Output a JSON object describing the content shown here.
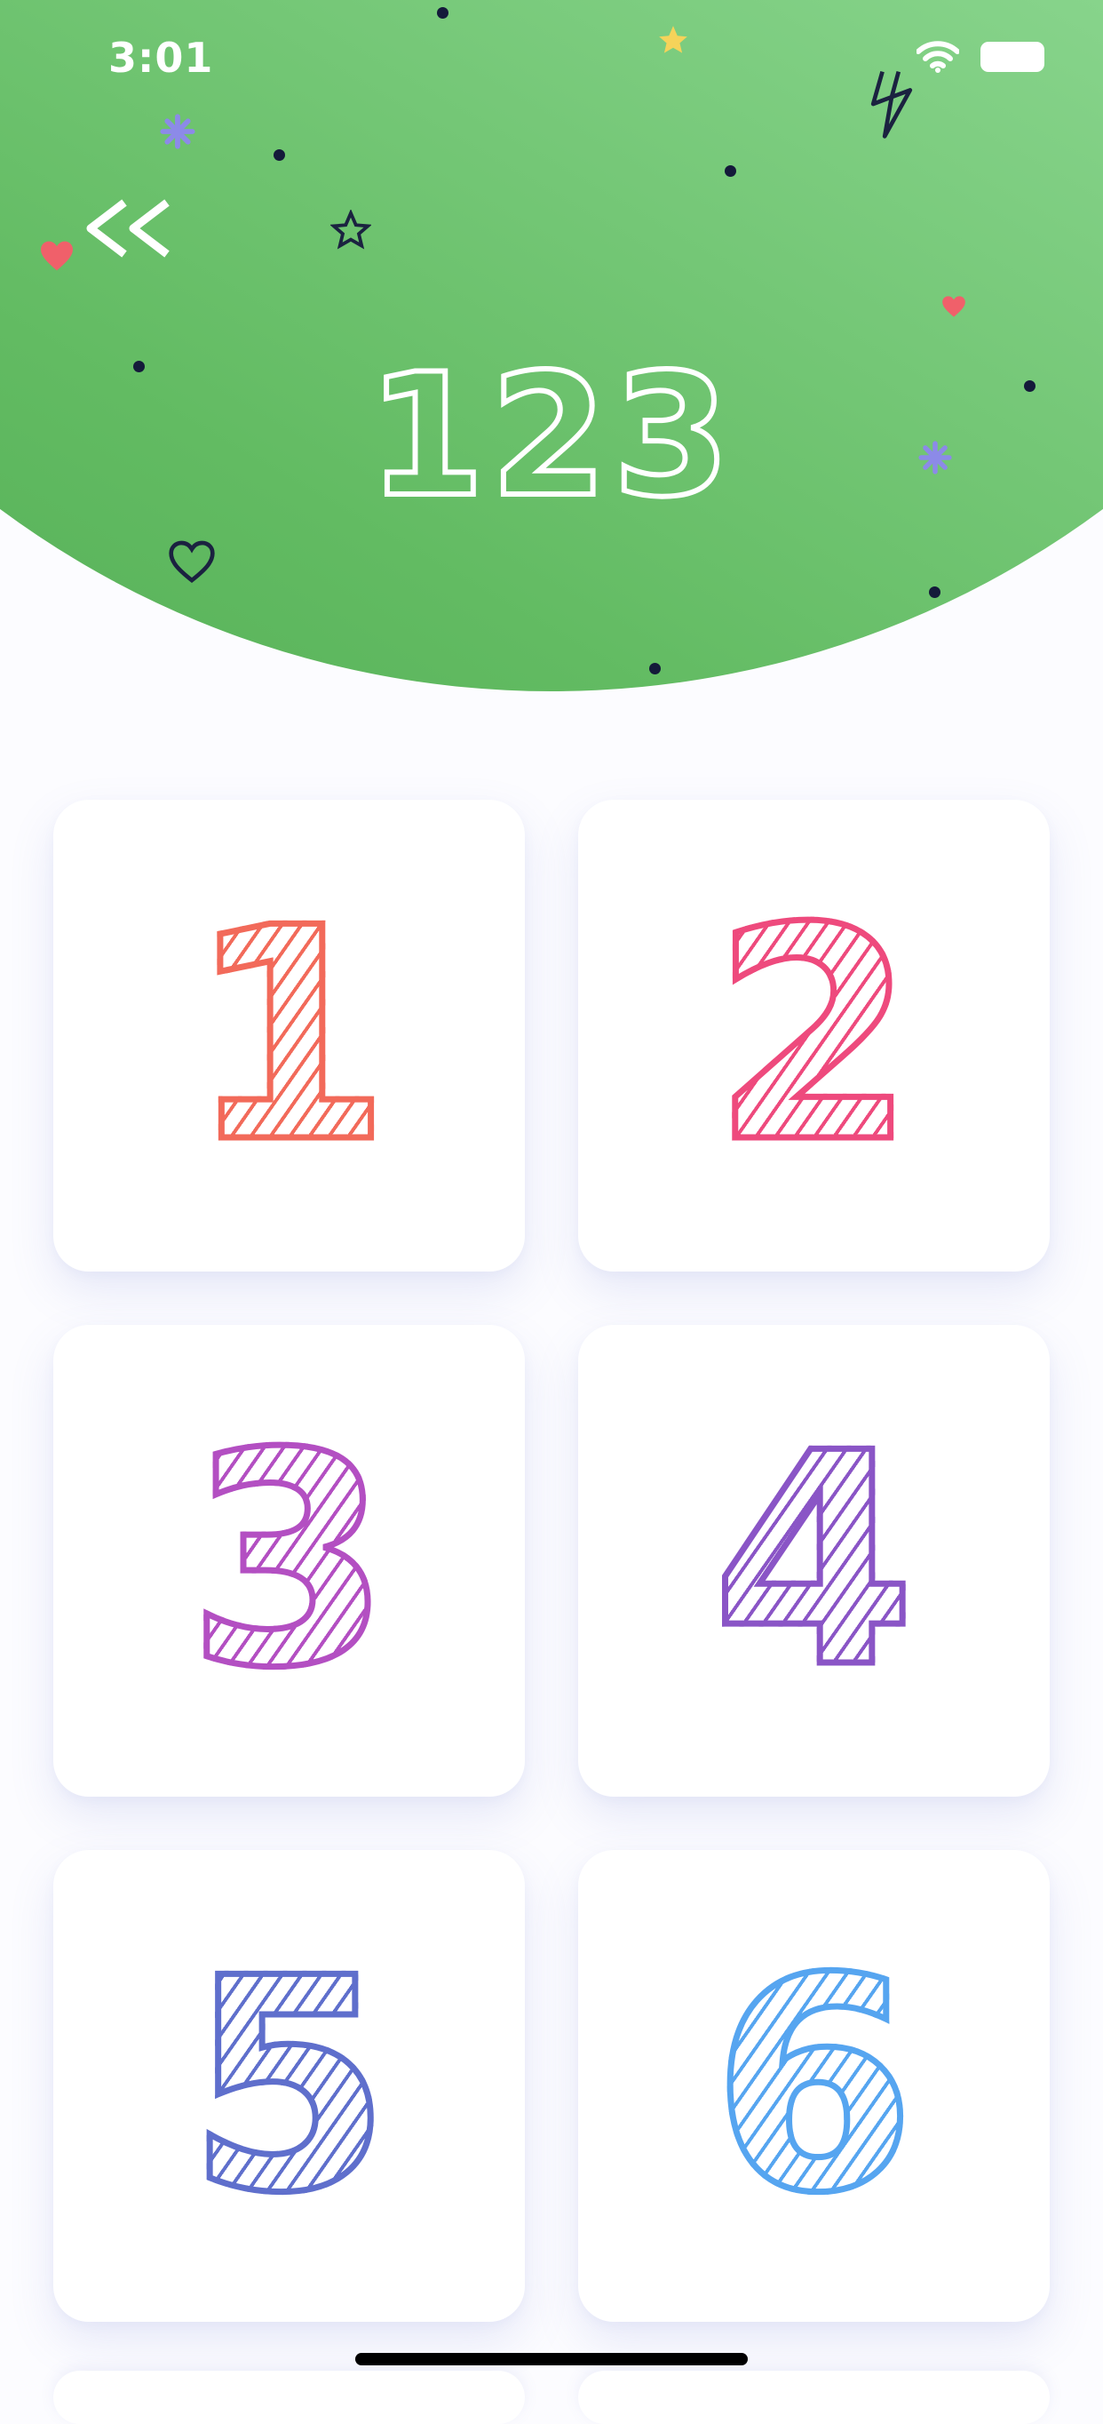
{
  "status_bar": {
    "time": "3:01"
  },
  "header": {
    "title": "123",
    "back_icon": "double-chevron-left-icon",
    "gradient": [
      "#b8f2c9",
      "#52ad55"
    ]
  },
  "cards": [
    {
      "label": "1",
      "color": "#f26a5a"
    },
    {
      "label": "2",
      "color": "#ee4a7d"
    },
    {
      "label": "3",
      "color": "#b34fc2"
    },
    {
      "label": "4",
      "color": "#8a55c6"
    },
    {
      "label": "5",
      "color": "#5f6fcc"
    },
    {
      "label": "6",
      "color": "#56a5f0"
    }
  ]
}
